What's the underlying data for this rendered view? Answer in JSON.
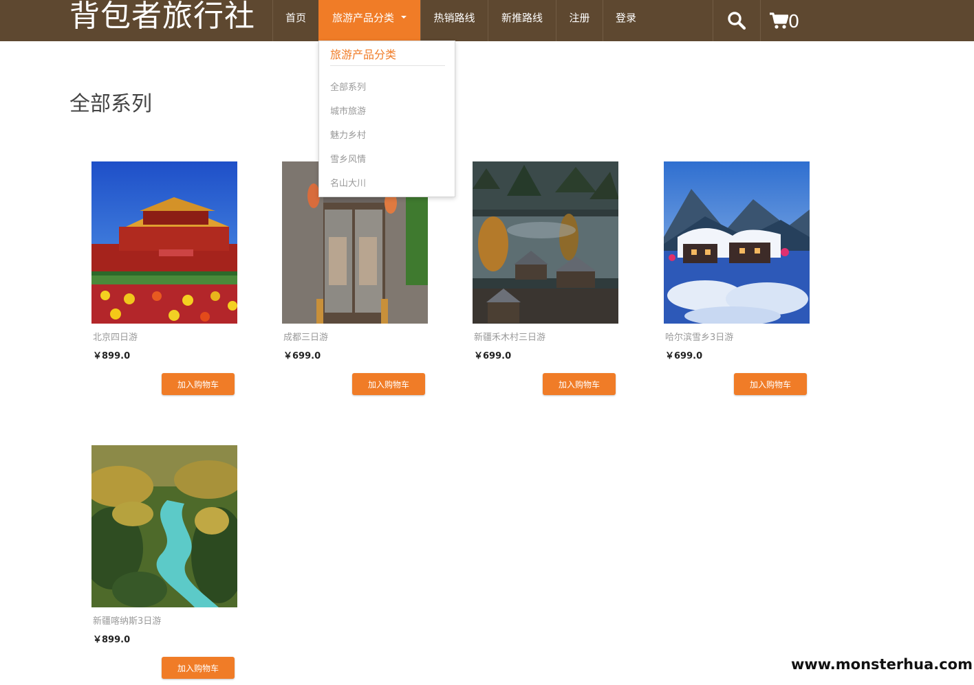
{
  "header": {
    "brand": "背包者旅行社",
    "nav": {
      "home": "首页",
      "category": "旅游产品分类",
      "hot": "热销路线",
      "new": "新推路线",
      "register": "注册",
      "login": "登录"
    },
    "cart_count": "0"
  },
  "dropdown": {
    "header": "旅游产品分类",
    "items": [
      "全部系列",
      "城市旅游",
      "魅力乡村",
      "雪乡风情",
      "名山大川"
    ]
  },
  "main": {
    "title": "全部系列",
    "products": [
      {
        "name": "北京四日游",
        "price": "￥899.0",
        "button": "加入购物车",
        "image": "tiananmen-gate"
      },
      {
        "name": "成都三日游",
        "price": "￥699.0",
        "button": "加入购物车",
        "image": "chengdu-old-door"
      },
      {
        "name": "新疆禾木村三日游",
        "price": "￥699.0",
        "button": "加入购物车",
        "image": "hemu-village"
      },
      {
        "name": "哈尔滨雪乡3日游",
        "price": "￥699.0",
        "button": "加入购物车",
        "image": "snow-town"
      },
      {
        "name": "新疆喀纳斯3日游",
        "price": "￥899.0",
        "button": "加入购物车",
        "image": "kanas-river"
      }
    ]
  },
  "watermark": "www.monsterhua.com",
  "colors": {
    "navbar": "#5e4830",
    "accent": "#f07c27"
  }
}
